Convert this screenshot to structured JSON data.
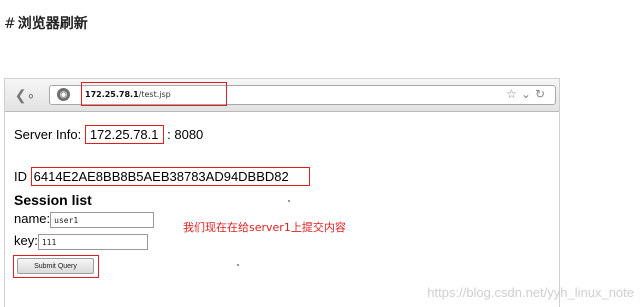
{
  "heading": {
    "hash": "#",
    "text": "浏览器刷新"
  },
  "browser": {
    "url_host": "172.25.78.1",
    "url_path": "/test.jsp",
    "icons": [
      "back-icon",
      "globe-icon",
      "star-icon",
      "dropdown-icon",
      "reload-icon"
    ]
  },
  "page": {
    "server_info_label": "Server Info:",
    "server_ip": "172.25.78.1",
    "server_port": ": 8080",
    "id_label": "ID",
    "session_id": "6414E2AE8BB8B5AEB38783AD94DBBD82",
    "session_list_title": "Session list",
    "name_label": "name:",
    "name_value": "user1",
    "key_label": "key:",
    "key_value": "111",
    "submit_label": "Submit Query"
  },
  "annotation": "我们现在在给server1上提交内容",
  "watermark": "https://blog.csdn.net/yyh_linux_note",
  "colors": {
    "highlight": "#e02020",
    "annotation": "#e02020"
  }
}
